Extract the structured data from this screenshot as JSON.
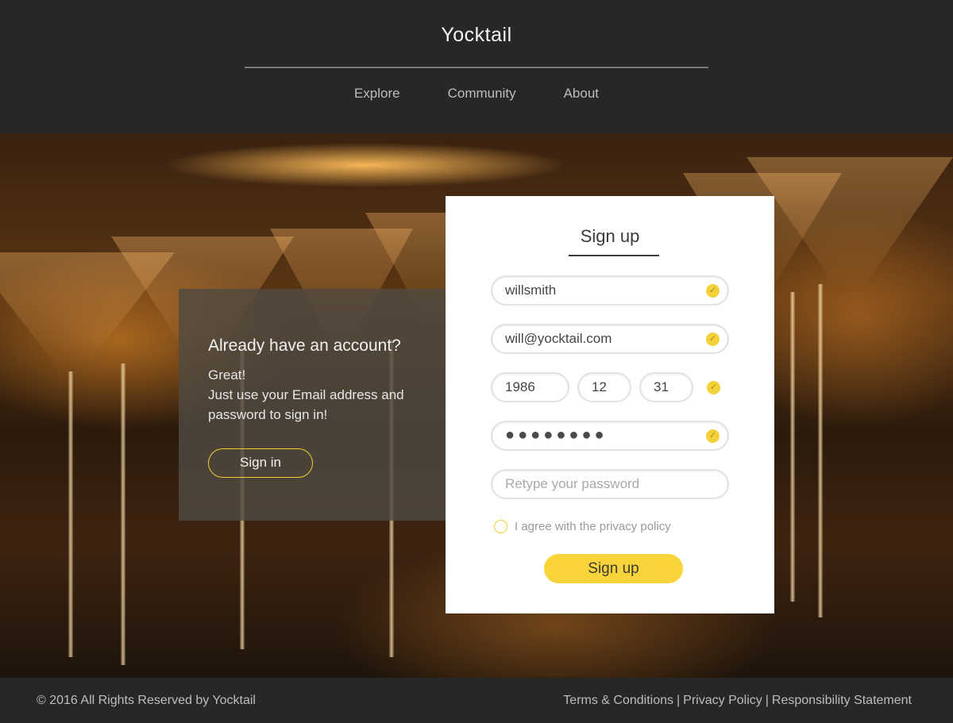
{
  "header": {
    "brand": "Yocktail",
    "nav": [
      "Explore",
      "Community",
      "About"
    ]
  },
  "login_prompt": {
    "title": "Already have an account?",
    "line1": "Great!",
    "line2": "Just use your Email address and password to sign in!",
    "button": "Sign in"
  },
  "signup": {
    "title": "Sign up",
    "username": "willsmith",
    "email": "will@yocktail.com",
    "birth_year": "1986",
    "birth_month": "12",
    "birth_day": "31",
    "password_mask": "●●●●●●●●",
    "retype_placeholder": "Retype your password",
    "agree_text": "I agree with the privacy policy",
    "button": "Sign up"
  },
  "footer": {
    "copyright": "© 2016 All Rights Reserved by Yocktail",
    "links": [
      "Terms & Conditions",
      "Privacy Policy",
      "Responsibility Statement"
    ]
  },
  "colors": {
    "accent": "#f8d43a",
    "dark": "#272727"
  },
  "icons": {
    "valid": "check-icon"
  }
}
